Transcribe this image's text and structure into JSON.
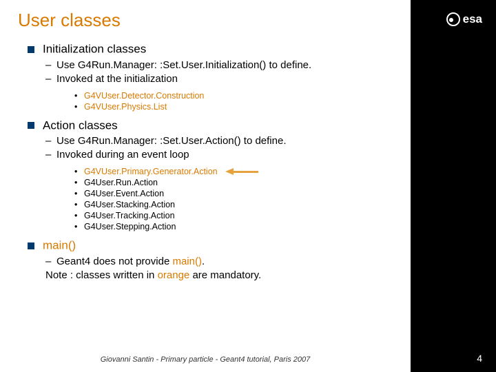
{
  "title": "User classes",
  "logo_text": "esa",
  "sections": {
    "init": {
      "heading": "Initialization classes",
      "sub1": "Use G4Run.Manager: :Set.User.Initialization() to define.",
      "sub2": "Invoked at the initialization",
      "items": [
        "G4VUser.Detector.Construction",
        "G4VUser.Physics.List"
      ]
    },
    "action": {
      "heading": "Action classes",
      "sub1": "Use G4Run.Manager: :Set.User.Action() to define.",
      "sub2": "Invoked during an event loop",
      "items": [
        "G4VUser.Primary.Generator.Action",
        "G4User.Run.Action",
        "G4User.Event.Action",
        "G4User.Stacking.Action",
        "G4User.Tracking.Action",
        "G4User.Stepping.Action"
      ]
    },
    "main": {
      "heading": "main()",
      "sub1_a": "Geant4 does not provide ",
      "sub1_b": "main()",
      "sub1_c": ".",
      "note_a": "Note : classes written in ",
      "note_b": "orange",
      "note_c": " are mandatory."
    }
  },
  "footer": "Giovanni Santin  -  Primary particle  -  Geant4 tutorial, Paris 2007",
  "page_number": "4"
}
